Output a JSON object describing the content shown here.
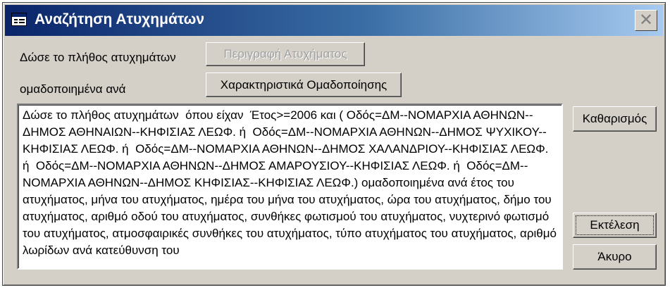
{
  "window": {
    "title": "Αναζήτηση Ατυχημάτων",
    "close_symbol": "✕"
  },
  "form": {
    "label_count": "Δώσε το πλήθος ατυχημάτων",
    "label_grouped": "ομαδοποιημένα ανά",
    "btn_description": "Περιγραφή Ατυχήματος",
    "btn_grouping": "Χαρακτηριστικά Ομαδοποίησης",
    "query_text": "Δώσε το πλήθος ατυχημάτων  όπου είχαν  Έτος>=2006 και ( Οδός=ΔΜ--ΝΟΜΑΡΧΙΑ ΑΘΗΝΩΝ--ΔΗΜΟΣ ΑΘΗΝΑΙΩΝ--ΚΗΦΙΣΙΑΣ ΛΕΩΦ. ή  Οδός=ΔΜ--ΝΟΜΑΡΧΙΑ ΑΘΗΝΩΝ--ΔΗΜΟΣ ΨΥΧΙΚΟΥ--ΚΗΦΙΣΙΑΣ ΛΕΩΦ. ή  Οδός=ΔΜ--ΝΟΜΑΡΧΙΑ ΑΘΗΝΩΝ--ΔΗΜΟΣ ΧΑΛΑΝΔΡΙΟΥ--ΚΗΦΙΣΙΑΣ ΛΕΩΦ. ή  Οδός=ΔΜ--ΝΟΜΑΡΧΙΑ ΑΘΗΝΩΝ--ΔΗΜΟΣ ΑΜΑΡΟΥΣΙΟΥ--ΚΗΦΙΣΙΑΣ ΛΕΩΦ. ή  Οδός=ΔΜ--ΝΟΜΑΡΧΙΑ ΑΘΗΝΩΝ--ΔΗΜΟΣ ΚΗΦΙΣΙΑΣ--ΚΗΦΙΣΙΑΣ ΛΕΩΦ.) ομαδοποιημένα ανά έτος του ατυχήματος, μήνα του ατυχήματος, ημέρα του μήνα του ατυχήματος, ώρα του ατυχήματος, δήμο του ατυχήματος, αριθμό οδού του ατυχήματος, συνθήκες φωτισμού του ατυχήματος, νυχτερινό φωτισμό του ατυχήματος, ατμοσφαιρικές συνθήκες του ατυχήματος, τύπο ατυχήματος του ατυχήματος, αριθμό λωρίδων ανά κατεύθυνση του"
  },
  "actions": {
    "clear": "Καθαρισμός",
    "execute": "Εκτέλεση",
    "cancel": "Άκυρο"
  }
}
